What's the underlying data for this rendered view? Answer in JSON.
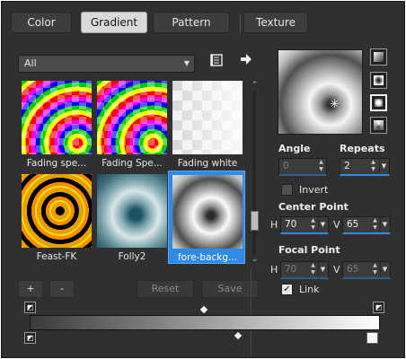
{
  "tabs": [
    {
      "label": "Color",
      "active": false
    },
    {
      "label": "Gradient",
      "active": true
    },
    {
      "label": "Pattern",
      "active": false
    },
    {
      "label": "Texture",
      "active": false
    }
  ],
  "category_select": {
    "value": "All"
  },
  "gallery": {
    "items": [
      {
        "label": "Fading spe...",
        "icon": "rainbow-checker-radial"
      },
      {
        "label": "Fading Spe...",
        "icon": "rainbow-checker-radial"
      },
      {
        "label": "Fading white",
        "icon": "white-checker-fade"
      },
      {
        "label": "Feast-FK",
        "icon": "black-gold-rings"
      },
      {
        "label": "Folly2",
        "icon": "teal-radial"
      },
      {
        "label": "fore-backg...",
        "icon": "gray-radial",
        "selected": true
      }
    ]
  },
  "buttons": {
    "add": "+",
    "remove": "-",
    "reset": "Reset",
    "save": "Save"
  },
  "icons": {
    "manage": "library-icon",
    "arrow": "right-arrow-icon"
  },
  "angle": {
    "label": "Angle",
    "value": "0"
  },
  "repeats": {
    "label": "Repeats",
    "value": "2"
  },
  "invert": {
    "label": "Invert",
    "checked": false
  },
  "center_point": {
    "label": "Center Point",
    "h_label": "H",
    "h_value": "70",
    "v_label": "V",
    "v_value": "65"
  },
  "focal_point": {
    "label": "Focal Point",
    "h_label": "H",
    "h_value": "70",
    "v_label": "V",
    "v_value": "65"
  },
  "link": {
    "label": "Link",
    "checked": true
  },
  "gradient": {
    "start_color": "#3a3a3a",
    "end_color": "#ffffff",
    "style": "radial"
  },
  "accent_color": "#2f8ae6"
}
